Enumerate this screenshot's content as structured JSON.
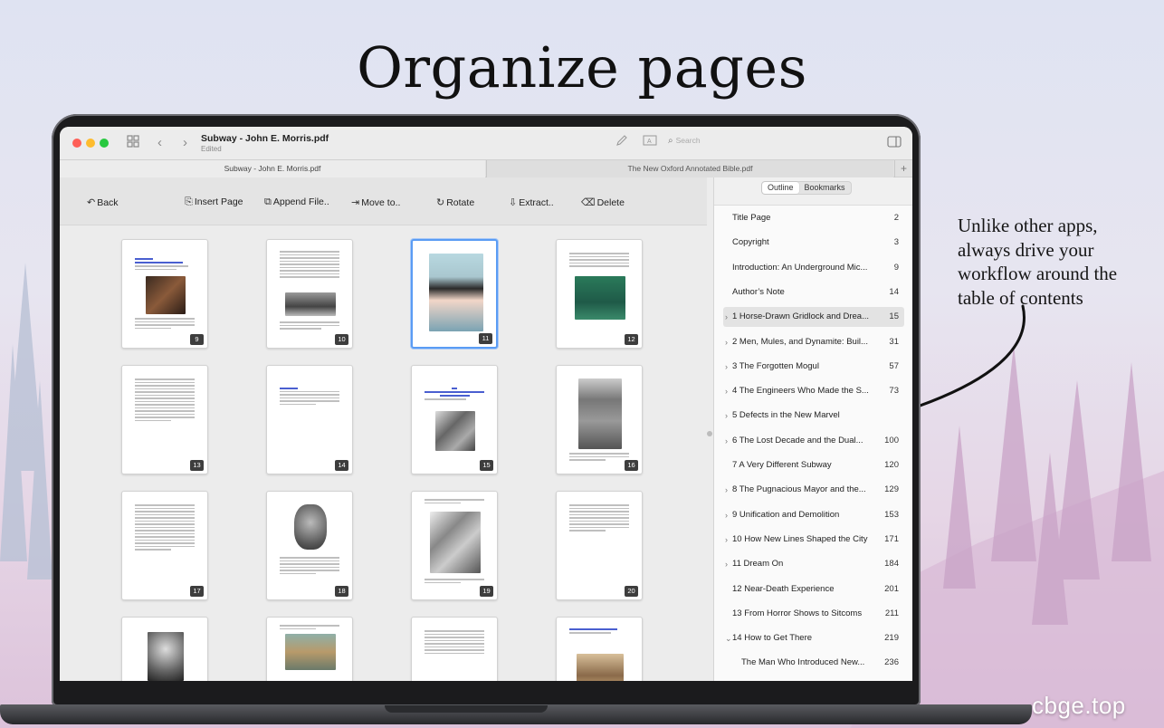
{
  "headline": "Organize pages",
  "callout": {
    "lines": [
      "Unlike other apps,",
      "always drive your",
      "workflow around the",
      "table of contents"
    ]
  },
  "watermark": "cbge.top",
  "window": {
    "doc_title": "Subway - John E. Morris.pdf",
    "doc_status": "Edited",
    "search_placeholder": "Search"
  },
  "tabs": [
    {
      "label": "Subway - John E. Morris.pdf",
      "active": true
    },
    {
      "label": "The New Oxford Annotated Bible.pdf",
      "active": false
    }
  ],
  "tab_add": "+",
  "toolbar": {
    "back": "Back",
    "insert_page": "Insert Page",
    "append_file": "Append File..",
    "move_to": "Move to..",
    "rotate": "Rotate",
    "extract": "Extract..",
    "delete": "Delete"
  },
  "pages": [
    {
      "num": "9",
      "selected": false
    },
    {
      "num": "10",
      "selected": false
    },
    {
      "num": "11",
      "selected": true
    },
    {
      "num": "12",
      "selected": false
    },
    {
      "num": "13",
      "selected": false
    },
    {
      "num": "14",
      "selected": false
    },
    {
      "num": "15",
      "selected": false
    },
    {
      "num": "16",
      "selected": false
    },
    {
      "num": "17",
      "selected": false
    },
    {
      "num": "18",
      "selected": false
    },
    {
      "num": "19",
      "selected": false
    },
    {
      "num": "20",
      "selected": false
    },
    {
      "num": "",
      "selected": false
    },
    {
      "num": "",
      "selected": false
    },
    {
      "num": "",
      "selected": false
    },
    {
      "num": "",
      "selected": false
    }
  ],
  "sidebar": {
    "tab_outline": "Outline",
    "tab_bookmarks": "Bookmarks",
    "outline": [
      {
        "label": "Title Page",
        "page": "2",
        "chevron": ""
      },
      {
        "label": "Copyright",
        "page": "3",
        "chevron": ""
      },
      {
        "label": "Introduction: An Underground Mic...",
        "page": "9",
        "chevron": ""
      },
      {
        "label": "Author’s Note",
        "page": "14",
        "chevron": ""
      },
      {
        "label": "1 Horse-Drawn Gridlock and Drea...",
        "page": "15",
        "chevron": "›",
        "highlight": true
      },
      {
        "label": "2 Men, Mules, and Dynamite: Buil...",
        "page": "31",
        "chevron": "›"
      },
      {
        "label": "3 The Forgotten Mogul",
        "page": "57",
        "chevron": "›"
      },
      {
        "label": "4 The Engineers Who Made the S...",
        "page": "73",
        "chevron": "›"
      },
      {
        "label": "5 Defects in the New Marvel",
        "page": "",
        "chevron": "›"
      },
      {
        "label": "6 The Lost Decade and the Dual...",
        "page": "100",
        "chevron": "›"
      },
      {
        "label": "7 A Very Different Subway",
        "page": "120",
        "chevron": ""
      },
      {
        "label": "8 The Pugnacious Mayor and the...",
        "page": "129",
        "chevron": "›"
      },
      {
        "label": "9 Unification and Demolition",
        "page": "153",
        "chevron": "›"
      },
      {
        "label": "10 How New Lines Shaped the City",
        "page": "171",
        "chevron": "›"
      },
      {
        "label": "11 Dream On",
        "page": "184",
        "chevron": "›"
      },
      {
        "label": "12 Near-Death Experience",
        "page": "201",
        "chevron": ""
      },
      {
        "label": "13 From Horror Shows to Sitcoms",
        "page": "211",
        "chevron": ""
      },
      {
        "label": "14 How to Get There",
        "page": "219",
        "chevron": "⌄"
      },
      {
        "label": "The Man Who Introduced New...",
        "page": "236",
        "chevron": "",
        "indent": true
      }
    ]
  },
  "colors": {
    "selection": "#5a9cf4",
    "traffic_red": "#fe5f57",
    "traffic_yellow": "#febc2e",
    "traffic_green": "#28c840"
  }
}
